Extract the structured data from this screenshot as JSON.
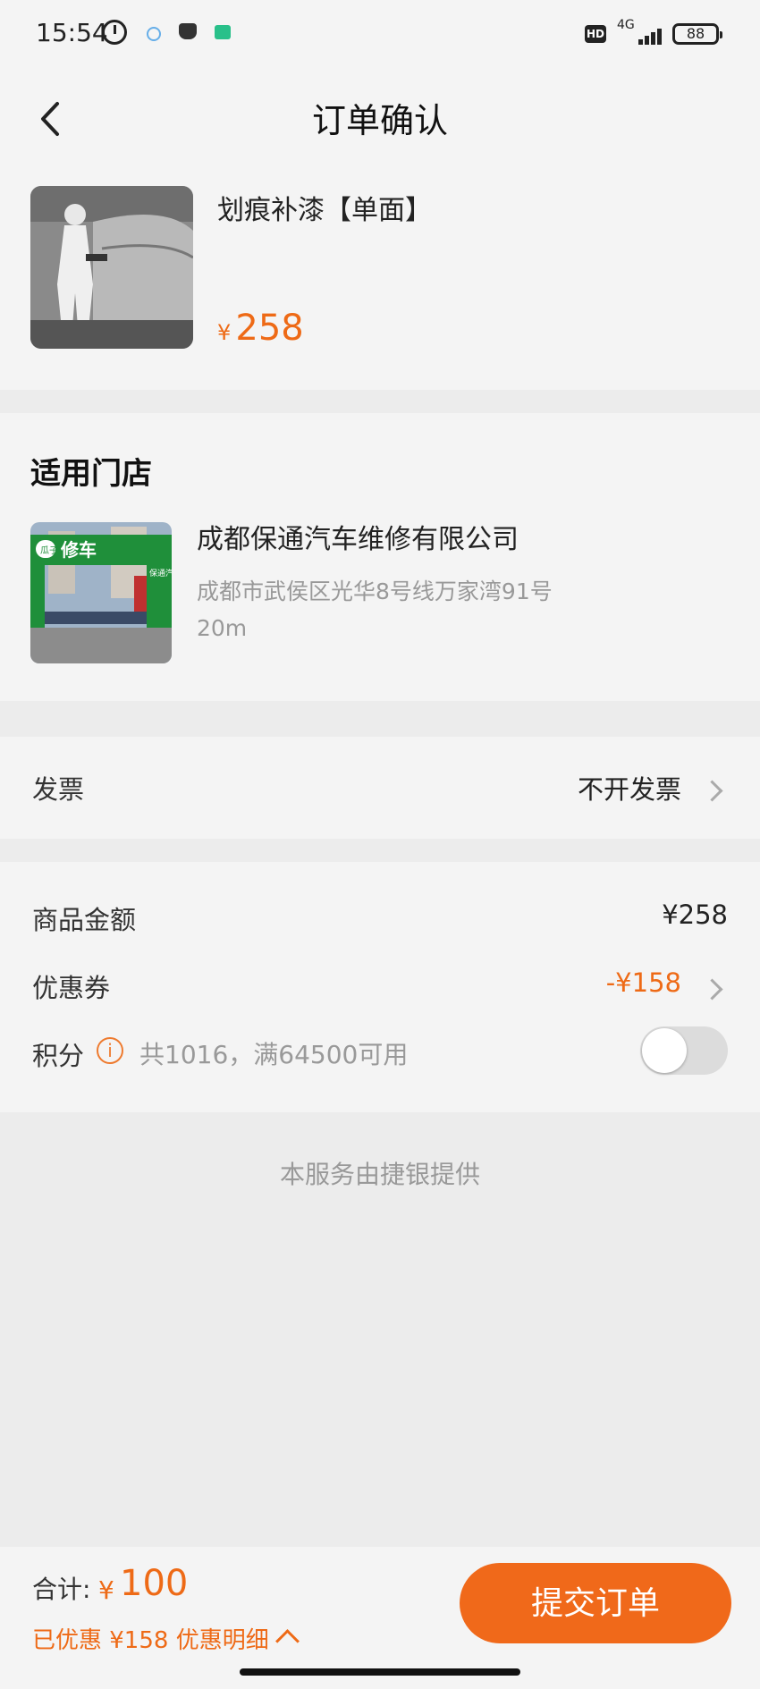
{
  "status_bar": {
    "time": "15:54",
    "hd": "HD",
    "network": "4G",
    "battery": "88"
  },
  "nav": {
    "title": "订单确认",
    "back_icon": "chevron-left-icon"
  },
  "product": {
    "title": "划痕补漆【单面】",
    "currency": "¥",
    "price": "258",
    "image": "car-painting-photo"
  },
  "store": {
    "heading": "适用门店",
    "name": "成都保通汽车维修有限公司",
    "address": "成都市武侯区光华8号线万家湾91号",
    "distance": "20m",
    "image": "store-front-photo",
    "sign_text": [
      "瓜子",
      "修车",
      "保通汽修"
    ]
  },
  "invoice": {
    "label": "发票",
    "value": "不开发票"
  },
  "amounts": {
    "goods_label": "商品金额",
    "goods_value": "¥258",
    "coupon_label": "优惠券",
    "coupon_value": "-¥158",
    "points_label": "积分",
    "points_note": "共1016，满64500可用",
    "points_toggle_on": false
  },
  "provider_text": "本服务由捷银提供",
  "bottom": {
    "total_label": "合计:",
    "total_currency": "¥",
    "total_value": "100",
    "saved_text": "已优惠 ¥158 优惠明细",
    "submit_label": "提交订单"
  },
  "colors": {
    "accent": "#f0691a",
    "background": "#ececec",
    "card": "#f4f4f4",
    "muted_text": "#999999"
  }
}
